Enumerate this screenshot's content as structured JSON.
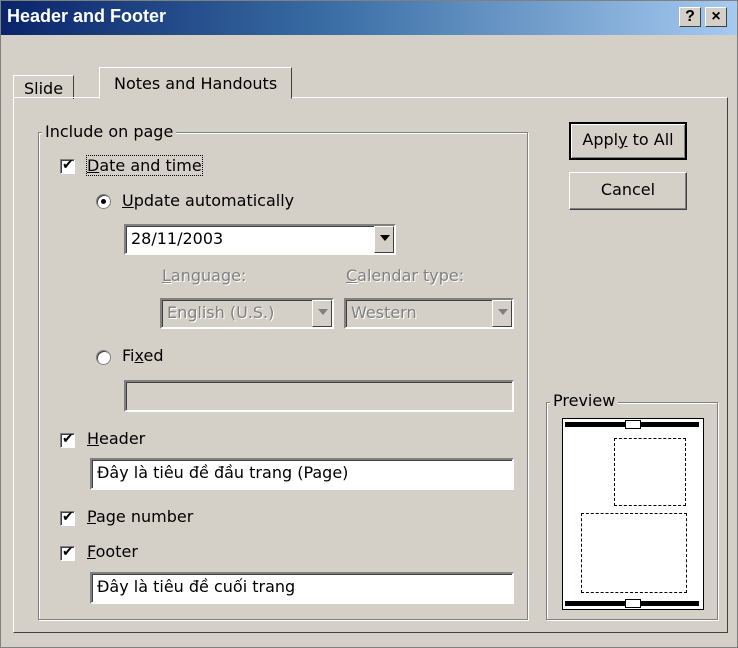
{
  "window": {
    "title": "Header and Footer",
    "help_label": "?",
    "close_label": "×"
  },
  "tabs": [
    {
      "label": "Slide"
    },
    {
      "label": "Notes and Handouts"
    }
  ],
  "include_group": {
    "label": "Include on page"
  },
  "date_time": {
    "checked": true,
    "label_first": "D",
    "label_rest": "ate and time",
    "update_auto": {
      "selected": true,
      "label_first": "U",
      "label_rest": "pdate automatically"
    },
    "date_value": "28/11/2003",
    "language": {
      "label_first": "L",
      "label_rest": "anguage:",
      "value": "English (U.S.)"
    },
    "calendar": {
      "label_first": "C",
      "label_rest": "alendar type:",
      "value": "Western"
    },
    "fixed": {
      "selected": false,
      "label_pre": "Fi",
      "label_under": "x",
      "label_post": "ed",
      "value": ""
    }
  },
  "header": {
    "checked": true,
    "label_first": "H",
    "label_rest": "eader",
    "value": "Đây là tiêu đề đầu trang (Page)"
  },
  "page_number": {
    "checked": true,
    "label_first": "P",
    "label_rest": "age number"
  },
  "footer": {
    "checked": true,
    "label_first": "F",
    "label_rest": "ooter",
    "value": "Đây là tiêu đề cuối trang"
  },
  "buttons": {
    "apply_pre": "Appl",
    "apply_under": "y",
    "apply_post": " to All",
    "cancel": "Cancel"
  },
  "preview": {
    "label": "Preview"
  }
}
